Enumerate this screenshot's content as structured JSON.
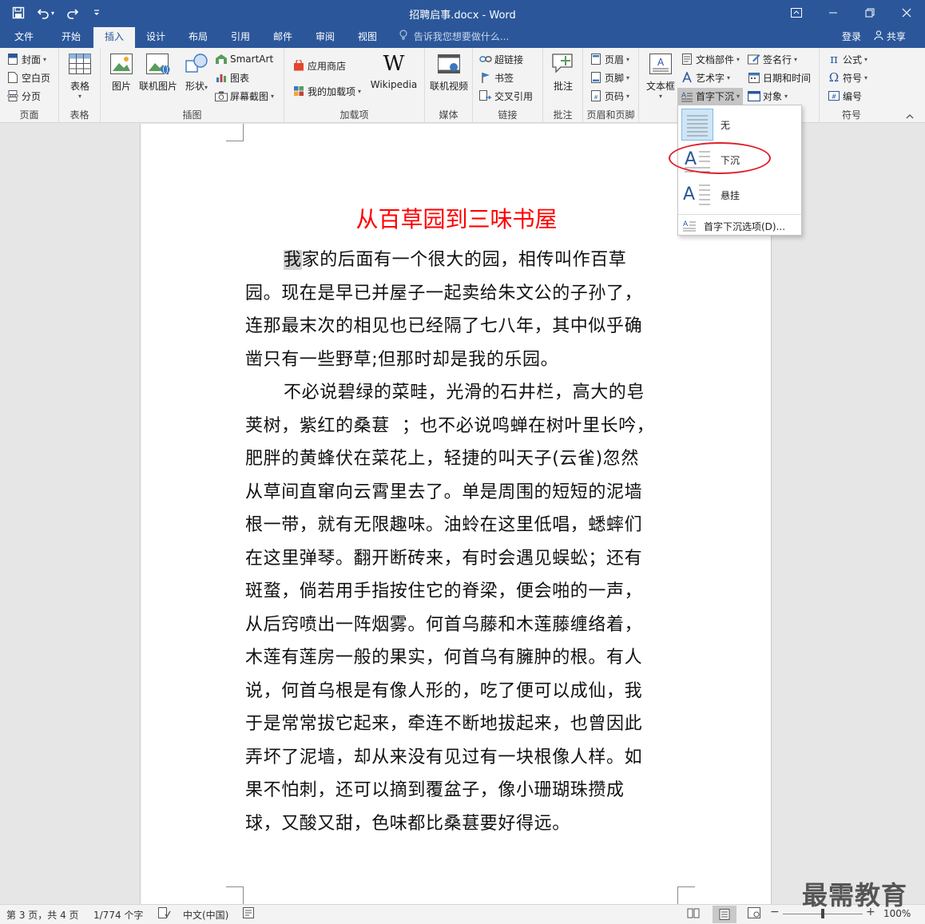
{
  "titlebar": {
    "title": "招聘启事.docx - Word",
    "save_icon": "save-icon",
    "undo_icon": "undo-icon",
    "redo_icon": "redo-icon"
  },
  "tabs": [
    {
      "label": "文件"
    },
    {
      "label": "开始"
    },
    {
      "label": "插入"
    },
    {
      "label": "设计"
    },
    {
      "label": "布局"
    },
    {
      "label": "引用"
    },
    {
      "label": "邮件"
    },
    {
      "label": "审阅"
    },
    {
      "label": "视图"
    }
  ],
  "tell_me": "告诉我您想要做什么...",
  "login": "登录",
  "share": "共享",
  "ribbon": {
    "pages": {
      "cover": "封面",
      "blank": "空白页",
      "break": "分页",
      "label": "页面"
    },
    "tables": {
      "table": "表格",
      "label": "表格"
    },
    "illustrations": {
      "picture": "图片",
      "online_picture": "联机图片",
      "shapes": "形状",
      "smartart": "SmartArt",
      "chart": "图表",
      "screenshot": "屏幕截图",
      "label": "插图"
    },
    "addins": {
      "store": "应用商店",
      "my_addins": "我的加载项",
      "wikipedia": "Wikipedia",
      "label": "加载项"
    },
    "media": {
      "online_video": "联机视频",
      "label": "媒体"
    },
    "links": {
      "hyperlink": "超链接",
      "bookmark": "书签",
      "crossref": "交叉引用",
      "label": "链接"
    },
    "comments": {
      "comment": "批注",
      "label": "批注"
    },
    "header_footer": {
      "header": "页眉",
      "footer": "页脚",
      "page_number": "页码",
      "label": "页眉和页脚"
    },
    "text": {
      "textbox": "文本框",
      "quick_parts": "文档部件",
      "wordart": "艺术字",
      "dropcap": "首字下沉",
      "signature": "签名行",
      "datetime": "日期和时间",
      "object": "对象"
    },
    "symbols": {
      "equation": "公式",
      "symbol": "符号",
      "number": "编号",
      "label": "符号"
    }
  },
  "dropdown": {
    "options": [
      {
        "label": "无"
      },
      {
        "label": "下沉"
      },
      {
        "label": "悬挂"
      }
    ],
    "footer": "首字下沉选项(D)..."
  },
  "document": {
    "title": "从百草园到三味书屋",
    "para1": {
      "dropcap": "我",
      "lines": [
        "家的后面有一个很大的园，相传叫作百草",
        "园。现在是早已并屋子一起卖给朱文公的子孙了，",
        "连那最末次的相见也已经隔了七八年，其中似乎确",
        "凿只有一些野草;但那时却是我的乐园。"
      ]
    },
    "para2": {
      "lines": [
        "不必说碧绿的菜畦，光滑的石井栏，高大的皂",
        "荚树，紫红的桑葚  ；也不必说鸣蝉在树叶里长吟，",
        "肥胖的黄蜂伏在菜花上，轻捷的叫天子(云雀)忽然",
        "从草间直窜向云霄里去了。单是周围的短短的泥墙",
        "根一带，就有无限趣味。油蛉在这里低唱，蟋蟀们",
        "在这里弹琴。翻开断砖来，有时会遇见蜈蚣；还有",
        "斑蝥，倘若用手指按住它的脊梁，便会啪的一声，",
        "从后窍喷出一阵烟雾。何首乌藤和木莲藤缠络着，",
        "木莲有莲房一般的果实，何首乌有臃肿的根。有人",
        "说，何首乌根是有像人形的，吃了便可以成仙，我",
        "于是常常拔它起来，牵连不断地拔起来，也曾因此",
        "弄坏了泥墙，却从来没有见过有一块根像人样。如",
        "果不怕刺，还可以摘到覆盆子，像小珊瑚珠攒成",
        "球，又酸又甜，色味都比桑葚要好得远。"
      ]
    }
  },
  "statusbar": {
    "page": "第 3 页，共 4 页",
    "words": "1/774 个字",
    "language": "中文(中国)",
    "zoom": "100%",
    "zoom_level": 1.0
  },
  "watermark": "最需教育",
  "colors": {
    "accent": "#2b579a",
    "title_red": "#ff0000",
    "circle_red": "#e0202a"
  }
}
